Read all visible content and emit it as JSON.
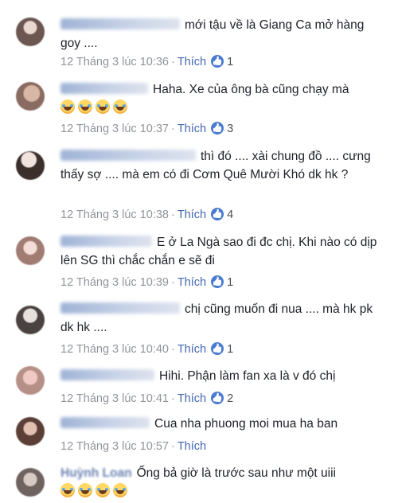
{
  "like_label": "Thích",
  "comments": [
    {
      "text": "mới tậu về là Giang Ca mở hàng goy ....",
      "timestamp": "12 Tháng 3 lúc 10:36",
      "likes": "1"
    },
    {
      "text": "Haha. Xe của ông bà cũng chạy mà",
      "timestamp": "12 Tháng 3 lúc 10:37",
      "likes": "3"
    },
    {
      "text": "thì đó .... xài chung đồ .... cưng thấy sợ .... mà em có đi Cơm Quê Mười Khó dk hk ?",
      "timestamp": "12 Tháng 3 lúc 10:38",
      "likes": "4"
    },
    {
      "text": "E ở La Ngà sao đi đc chị. Khi nào có dịp lên SG thì chắc chắn e sẽ đi",
      "timestamp": "12 Tháng 3 lúc 10:39",
      "likes": "1"
    },
    {
      "text": "chị cũng muốn đi nua .... mà hk pk dk hk ....",
      "timestamp": "12 Tháng 3 lúc 10:40",
      "likes": "1"
    },
    {
      "text": "Hihi. Phận làm fan xa là v đó chị",
      "timestamp": "12 Tháng 3 lúc 10:41",
      "likes": "2"
    },
    {
      "text": "Cua nha phuong moi mua ha ban",
      "timestamp": "12 Tháng 3 lúc 10:57",
      "likes": ""
    },
    {
      "name": "Huỳnh Loan",
      "text": "Ống bả giờ là trước sau như một uiii",
      "timestamp": "",
      "likes": ""
    }
  ]
}
